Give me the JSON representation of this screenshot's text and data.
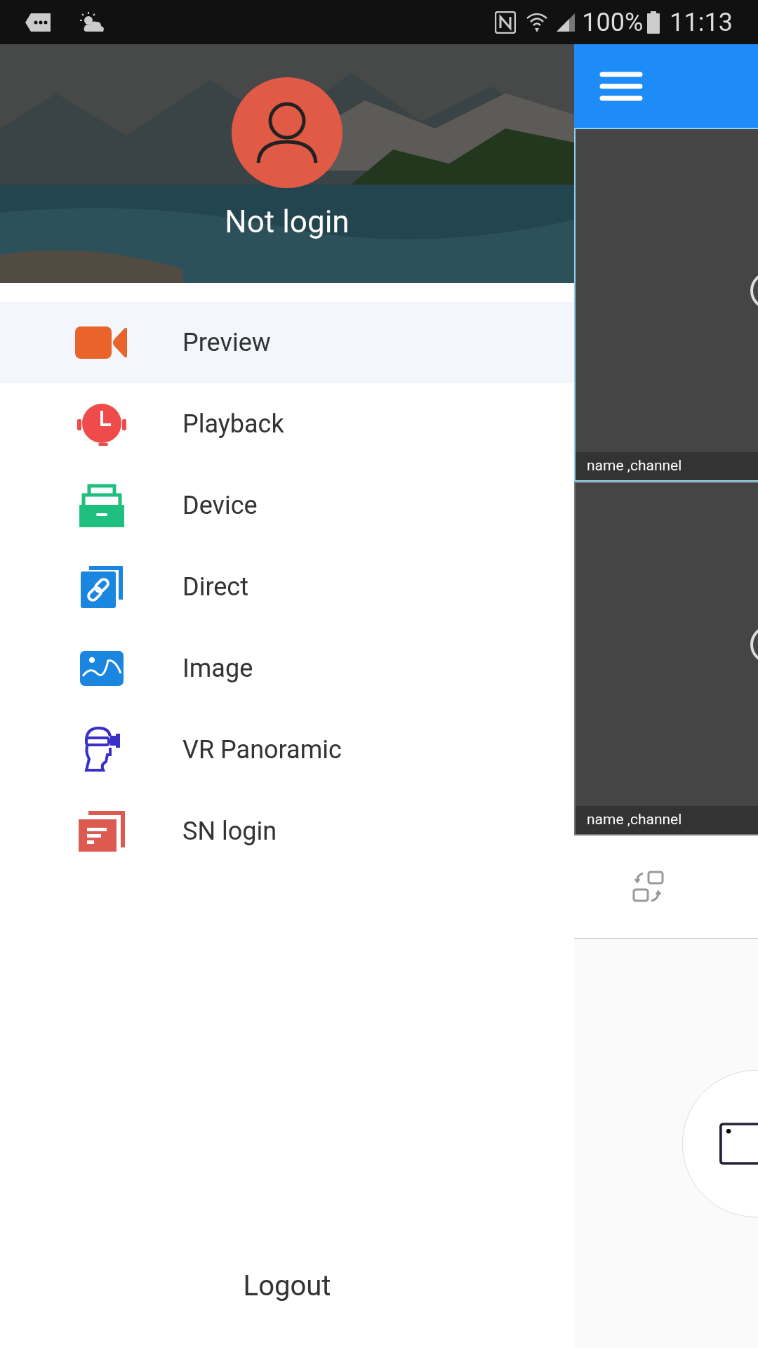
{
  "status_bar": {
    "battery": "100%",
    "time": "11:13"
  },
  "drawer": {
    "user_name": "Not login",
    "items": [
      {
        "label": "Preview",
        "selected": true
      },
      {
        "label": "Playback",
        "selected": false
      },
      {
        "label": "Device",
        "selected": false
      },
      {
        "label": "Direct",
        "selected": false
      },
      {
        "label": "Image",
        "selected": false
      },
      {
        "label": "VR Panoramic",
        "selected": false
      },
      {
        "label": "SN login",
        "selected": false
      }
    ],
    "logout": "Logout"
  },
  "preview": {
    "tiles": [
      {
        "caption": "name ,channel"
      },
      {
        "caption": "name ,channel"
      }
    ]
  }
}
